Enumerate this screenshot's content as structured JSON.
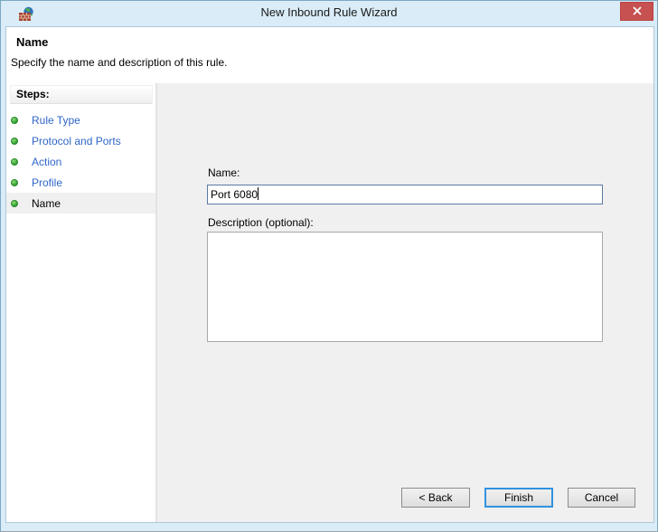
{
  "window": {
    "title": "New Inbound Rule Wizard"
  },
  "header": {
    "title": "Name",
    "subtitle": "Specify the name and description of this rule."
  },
  "sidebar": {
    "heading": "Steps:",
    "steps": [
      {
        "label": "Rule Type",
        "current": false
      },
      {
        "label": "Protocol and Ports",
        "current": false
      },
      {
        "label": "Action",
        "current": false
      },
      {
        "label": "Profile",
        "current": false
      },
      {
        "label": "Name",
        "current": true
      }
    ]
  },
  "form": {
    "name_label": "Name:",
    "name_value": "Port 6080",
    "description_label": "Description (optional):",
    "description_value": ""
  },
  "buttons": {
    "back": "< Back",
    "finish": "Finish",
    "cancel": "Cancel"
  },
  "icons": {
    "app": "firewall-icon",
    "close": "close-icon",
    "step_bullet": "green-dot-icon"
  },
  "colors": {
    "titlebar_bg": "#d9ecf7",
    "close_button": "#c75050",
    "step_link": "#2f66c8",
    "step_bullet": "#2f9e2f",
    "focused_input_border": "#5c79a3",
    "default_button_border": "#3292df",
    "content_bg": "#f0f0f0"
  }
}
